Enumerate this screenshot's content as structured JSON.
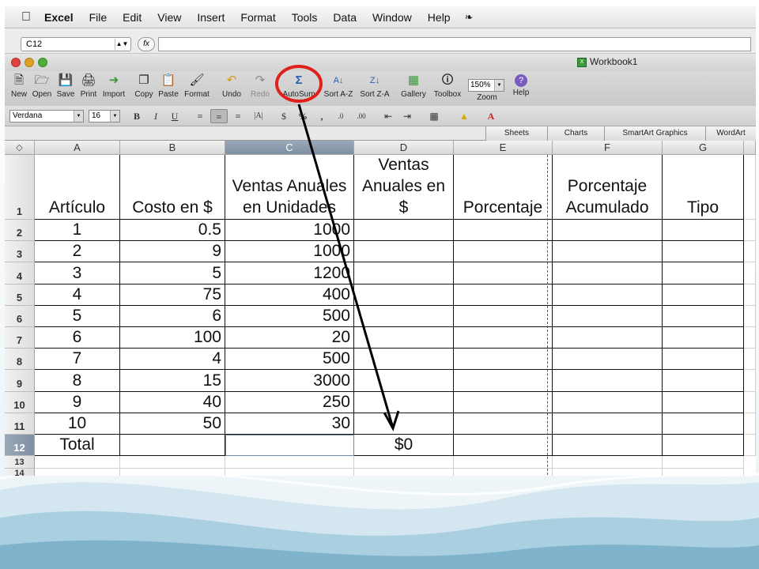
{
  "menubar": {
    "app_name": "Excel",
    "items": [
      "File",
      "Edit",
      "View",
      "Insert",
      "Format",
      "Tools",
      "Data",
      "Window",
      "Help"
    ],
    "script_icon": "script-icon"
  },
  "formula_bar": {
    "name_box": "C12",
    "fx_label": "fx",
    "formula": ""
  },
  "window": {
    "title": "Workbook1"
  },
  "toolbar": {
    "buttons": [
      {
        "label": "New",
        "icon": "new-icon"
      },
      {
        "label": "Open",
        "icon": "open-icon"
      },
      {
        "label": "Save",
        "icon": "save-icon"
      },
      {
        "label": "Print",
        "icon": "print-icon"
      },
      {
        "label": "Import",
        "icon": "import-icon"
      },
      {
        "label": "Copy",
        "icon": "copy-icon"
      },
      {
        "label": "Paste",
        "icon": "paste-icon"
      },
      {
        "label": "Format",
        "icon": "format-brush-icon"
      },
      {
        "label": "Undo",
        "icon": "undo-icon"
      },
      {
        "label": "Redo",
        "icon": "redo-icon"
      },
      {
        "label": "AutoSum",
        "icon": "autosum-icon"
      },
      {
        "label": "Sort A-Z",
        "icon": "sort-az-icon"
      },
      {
        "label": "Sort Z-A",
        "icon": "sort-za-icon"
      },
      {
        "label": "Gallery",
        "icon": "gallery-icon"
      },
      {
        "label": "Toolbox",
        "icon": "toolbox-icon"
      },
      {
        "label": "Zoom",
        "icon": "zoom-icon"
      },
      {
        "label": "Help",
        "icon": "help-icon"
      }
    ],
    "zoom_value": "150%"
  },
  "format_bar": {
    "font_name": "Verdana",
    "font_size": "16",
    "bold": "B",
    "italic": "I",
    "underline": "U"
  },
  "ribbon_tabs": [
    "Sheets",
    "Charts",
    "SmartArt Graphics",
    "WordArt"
  ],
  "sheet": {
    "columns": [
      "A",
      "B",
      "C",
      "D",
      "E",
      "F",
      "G"
    ],
    "selected_column": "C",
    "selected_row": 12,
    "header_row": [
      "Artículo",
      "Costo en $",
      "Ventas Anuales en Unidades",
      "Ventas Anuales en $",
      "Porcentaje",
      "Porcentaje Acumulado",
      "Tipo"
    ],
    "rows": [
      {
        "n": "2",
        "a": "1",
        "b": "0.5",
        "c": "1000"
      },
      {
        "n": "3",
        "a": "2",
        "b": "9",
        "c": "1000"
      },
      {
        "n": "4",
        "a": "3",
        "b": "5",
        "c": "1200"
      },
      {
        "n": "5",
        "a": "4",
        "b": "75",
        "c": "400"
      },
      {
        "n": "6",
        "a": "5",
        "b": "6",
        "c": "500"
      },
      {
        "n": "7",
        "a": "6",
        "b": "100",
        "c": "20"
      },
      {
        "n": "8",
        "a": "7",
        "b": "4",
        "c": "500"
      },
      {
        "n": "9",
        "a": "8",
        "b": "15",
        "c": "3000"
      },
      {
        "n": "10",
        "a": "9",
        "b": "40",
        "c": "250"
      },
      {
        "n": "11",
        "a": "10",
        "b": "50",
        "c": "30"
      }
    ],
    "total_row": {
      "n": "12",
      "a": "Total",
      "d": "$0"
    },
    "extra_rows": [
      "13",
      "14"
    ]
  },
  "annotation": {
    "highlight_target": "AutoSum",
    "ring_color": "#e0201b",
    "arrow_color": "#000000"
  },
  "colors": {
    "selection_header": "#8597ab",
    "wave_light": "#cfe3ee",
    "wave_dark": "#7fb3cc"
  }
}
